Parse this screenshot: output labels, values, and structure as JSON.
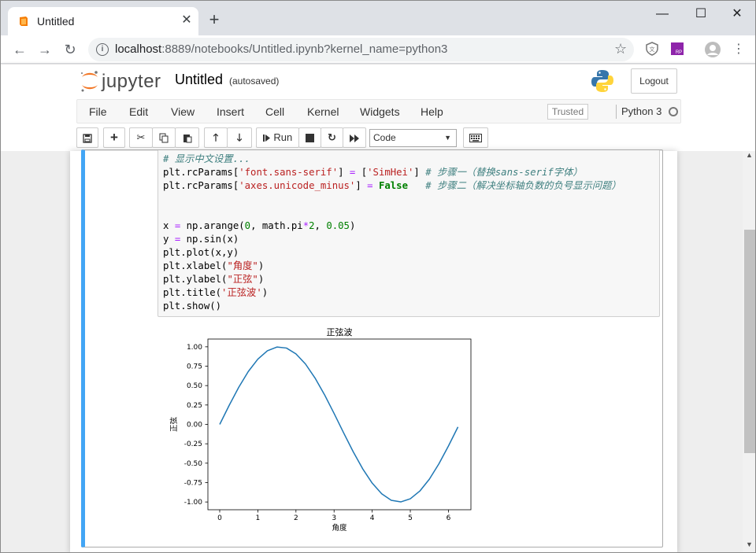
{
  "browser": {
    "tab_title": "Untitled",
    "close_glyph": "✕",
    "new_tab_glyph": "+",
    "window_controls": {
      "minimize": "—",
      "maximize": "☐",
      "close": "✕"
    },
    "url_host": "localhost",
    "url_rest": ":8889/notebooks/Untitled.ipynb?kernel_name=python3"
  },
  "jupyter": {
    "logo_text": "jupyter",
    "notebook_name": "Untitled",
    "save_status": "(autosaved)",
    "logout_label": "Logout",
    "menu": [
      "File",
      "Edit",
      "View",
      "Insert",
      "Cell",
      "Kernel",
      "Widgets",
      "Help"
    ],
    "trusted_label": "Trusted",
    "kernel_name": "Python 3",
    "run_label": "Run",
    "cell_type": "Code"
  },
  "code_lines": {
    "l1": "# 显示中文设置...",
    "l2a": "plt.rcParams[",
    "l2b": "'font.sans-serif'",
    "l2c": "] ",
    "l2d": "=",
    "l2e": " [",
    "l2f": "'SimHei'",
    "l2g": "] ",
    "l2h": "# 步骤一（替换sans-serif字体）",
    "l3a": "plt.rcParams[",
    "l3b": "'axes.unicode_minus'",
    "l3c": "] ",
    "l3d": "=",
    "l3e": " ",
    "l3f": "False",
    "l3g": "   ",
    "l3h": "# 步骤二（解决坐标轴负数的负号显示问题）",
    "l6a": "x ",
    "l6b": "=",
    "l6c": " np.arange(",
    "l6d": "0",
    "l6e": ", math.pi",
    "l6f": "*",
    "l6g": "2",
    "l6h": ", ",
    "l6i": "0.05",
    "l6j": ")",
    "l7a": "y ",
    "l7b": "=",
    "l7c": " np.sin(x)",
    "l8": "plt.plot(x,y)",
    "l9a": "plt.xlabel(",
    "l9b": "\"角度\"",
    "l9c": ")",
    "l10a": "plt.ylabel(",
    "l10b": "\"正弦\"",
    "l10c": ")",
    "l11a": "plt.title(",
    "l11b": "'正弦波'",
    "l11c": ")",
    "l12": "plt.show()"
  },
  "chart_data": {
    "type": "line",
    "title": "正弦波",
    "xlabel": "角度",
    "ylabel": "正弦",
    "xlim": [
      -0.31,
      6.59
    ],
    "ylim": [
      -1.1,
      1.1
    ],
    "xticks": [
      0,
      1,
      2,
      3,
      4,
      5,
      6
    ],
    "yticks": [
      1.0,
      0.75,
      0.5,
      0.25,
      0.0,
      -0.25,
      -0.5,
      -0.75,
      -1.0
    ],
    "ytick_labels": [
      "1.00",
      "0.75",
      "0.50",
      "0.25",
      "0.00",
      "-0.25",
      "-0.50",
      "-0.75",
      "-1.00"
    ],
    "series": [
      {
        "color": "#1f77b4",
        "x": [
          0.0,
          0.25,
          0.5,
          0.75,
          1.0,
          1.25,
          1.5,
          1.75,
          2.0,
          2.25,
          2.5,
          2.75,
          3.0,
          3.25,
          3.5,
          3.75,
          4.0,
          4.25,
          4.5,
          4.75,
          5.0,
          5.25,
          5.5,
          5.75,
          6.0,
          6.25
        ],
        "y": [
          0.0,
          0.247,
          0.479,
          0.682,
          0.841,
          0.949,
          0.997,
          0.984,
          0.909,
          0.778,
          0.598,
          0.382,
          0.141,
          -0.108,
          -0.351,
          -0.572,
          -0.757,
          -0.895,
          -0.978,
          -0.999,
          -0.959,
          -0.859,
          -0.706,
          -0.508,
          -0.279,
          -0.033
        ]
      }
    ],
    "grid": false,
    "legend": "none"
  }
}
